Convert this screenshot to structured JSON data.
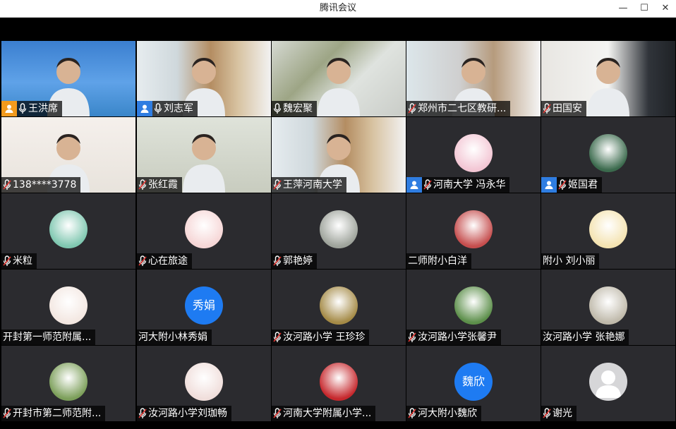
{
  "window": {
    "title": "腾讯会议",
    "minimize": "—",
    "maximize": "☐",
    "close": "✕"
  },
  "participants": [
    {
      "name": "王洪席",
      "kind": "video",
      "bg": "bg-sky",
      "host_icon": "orange",
      "mic": true,
      "active": false
    },
    {
      "name": "刘志军",
      "kind": "video",
      "bg": "bg-shelf",
      "host_icon": "blue",
      "mic": true,
      "active": true
    },
    {
      "name": "魏宏聚",
      "kind": "video",
      "bg": "bg-plant",
      "host_icon": null,
      "mic": true,
      "active": false
    },
    {
      "name": "郑州市二七区教研...",
      "kind": "video",
      "bg": "bg-office",
      "host_icon": null,
      "mic": "muted",
      "active": false
    },
    {
      "name": "田国安",
      "kind": "video",
      "bg": "bg-room",
      "host_icon": null,
      "mic": "muted",
      "active": false
    },
    {
      "name": "138****3778",
      "kind": "video",
      "bg": "bg-light",
      "host_icon": null,
      "mic": "muted",
      "active": false
    },
    {
      "name": "张红霞",
      "kind": "video",
      "bg": "bg-pale",
      "host_icon": null,
      "mic": "muted",
      "active": false
    },
    {
      "name": "王萍河南大学",
      "kind": "video",
      "bg": "bg-shelf",
      "host_icon": null,
      "mic": "muted",
      "active": false
    },
    {
      "name": "河南大学 冯永华",
      "kind": "avatar",
      "avatar_color": "#f3c6d4",
      "host_icon": "blue",
      "mic": "muted",
      "active": false
    },
    {
      "name": "姬国君",
      "kind": "avatar",
      "avatar_color": "#3b6a4d",
      "host_icon": "blue",
      "mic": "muted",
      "active": false
    },
    {
      "name": "米粒",
      "kind": "avatar",
      "avatar_color": "#7fc7b0",
      "host_icon": null,
      "mic": "muted",
      "active": false
    },
    {
      "name": "心在旅途",
      "kind": "avatar",
      "avatar_color": "#f6d6d6",
      "host_icon": null,
      "mic": "muted",
      "active": false
    },
    {
      "name": "郭艳婷",
      "kind": "avatar",
      "avatar_color": "#9ea39b",
      "host_icon": null,
      "mic": "muted",
      "active": false
    },
    {
      "name": "二师附小白洋",
      "kind": "avatar",
      "avatar_color": "#c54d4d",
      "host_icon": null,
      "mic": false,
      "active": false
    },
    {
      "name": "附小  刘小丽",
      "kind": "avatar",
      "avatar_color": "#f4e3b1",
      "host_icon": null,
      "mic": false,
      "active": false
    },
    {
      "name": "开封第一师范附属...",
      "kind": "avatar",
      "avatar_color": "#f3e7e1",
      "host_icon": null,
      "mic": false,
      "active": false
    },
    {
      "name": "河大附小林秀娟",
      "kind": "text",
      "avatar_text": "秀娟",
      "host_icon": null,
      "mic": false,
      "active": false
    },
    {
      "name": "汝河路小学 王珍珍",
      "kind": "avatar",
      "avatar_color": "#a48a46",
      "host_icon": null,
      "mic": "muted",
      "active": false
    },
    {
      "name": "汝河路小学张馨尹",
      "kind": "avatar",
      "avatar_color": "#5c8f4a",
      "host_icon": null,
      "mic": "muted",
      "active": false
    },
    {
      "name": "汝河路小学 张艳娜",
      "kind": "avatar",
      "avatar_color": "#bfb9aa",
      "host_icon": null,
      "mic": false,
      "active": false
    },
    {
      "name": "开封市第二师范附...",
      "kind": "avatar",
      "avatar_color": "#7c9f5a",
      "host_icon": null,
      "mic": "muted",
      "active": false
    },
    {
      "name": "汝河路小学刘珈畅",
      "kind": "avatar",
      "avatar_color": "#f0dedb",
      "host_icon": null,
      "mic": "muted",
      "active": false
    },
    {
      "name": "河南大学附属小学...",
      "kind": "avatar",
      "avatar_color": "#c6282d",
      "host_icon": null,
      "mic": "muted",
      "active": false
    },
    {
      "name": "河大附小魏欣",
      "kind": "text",
      "avatar_text": "魏欣",
      "host_icon": null,
      "mic": "muted",
      "active": false
    },
    {
      "name": "谢光",
      "kind": "blank",
      "host_icon": null,
      "mic": "muted",
      "active": false
    }
  ]
}
